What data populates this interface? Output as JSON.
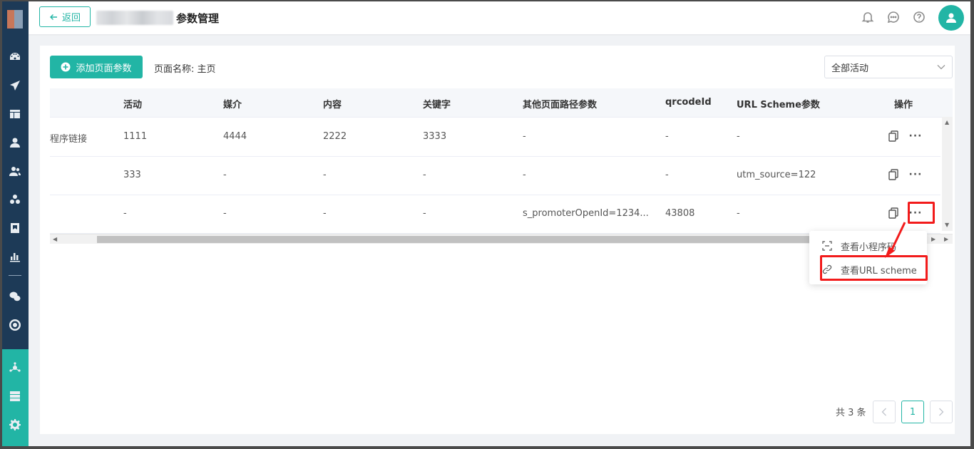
{
  "header": {
    "back_label": "返回",
    "page_title": "参数管理"
  },
  "toolbar": {
    "add_label": "添加页面参数",
    "page_name": "页面名称: 主页",
    "activity_select": "全部活动"
  },
  "table": {
    "columns": [
      "活动",
      "媒介",
      "内容",
      "关键字",
      "其他页面路径参数",
      "qrcodeId",
      "URL Scheme参数",
      "操作"
    ],
    "rows": [
      {
        "name": "程序链接",
        "activity": "1111",
        "medium": "4444",
        "content": "2222",
        "keyword": "3333",
        "path": "-",
        "qrcode": "-",
        "scheme": "-"
      },
      {
        "name": "",
        "activity": "333",
        "medium": "-",
        "content": "-",
        "keyword": "-",
        "path": "-",
        "qrcode": "-",
        "scheme": "utm_source=122"
      },
      {
        "name": "",
        "activity": "-",
        "medium": "-",
        "content": "-",
        "keyword": "-",
        "path": "s_promoterOpenId=1234...",
        "qrcode": "43808",
        "scheme": "-"
      }
    ],
    "more_label": "···"
  },
  "dropdown": {
    "items": [
      "查看小程序码",
      "查看URL scheme"
    ]
  },
  "pagination": {
    "total": "共 3 条",
    "current_page": "1"
  },
  "colors": {
    "accent": "#22b5a5",
    "sidebar": "#1d3a57",
    "highlight": "#f21b1b"
  }
}
